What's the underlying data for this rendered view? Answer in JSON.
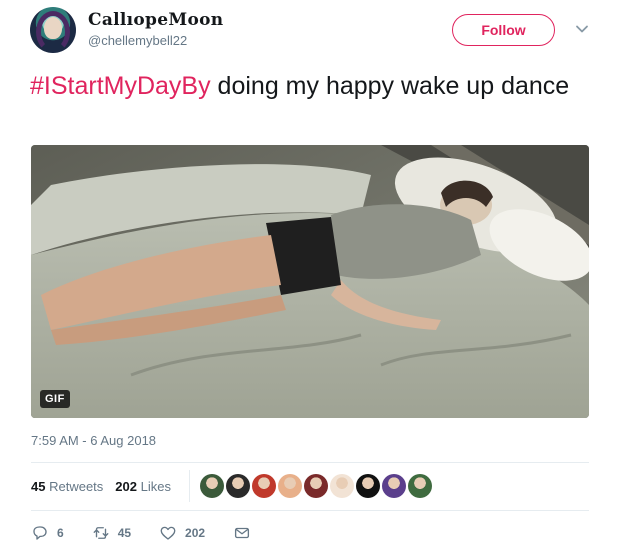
{
  "author": {
    "display_name": "CallıopeMoon",
    "handle": "@chellemybell22",
    "avatar_icon": "avatar"
  },
  "follow_label": "Follow",
  "tweet": {
    "hashtag": "#IStartMyDayBy",
    "text": " doing my happy wake up dance"
  },
  "media": {
    "badge": "GIF",
    "description_icon": "gif-video-person-dancing-in-bed"
  },
  "timestamp": "7:59 AM - 6 Aug 2018",
  "stats": {
    "retweets_count": "45",
    "retweets_label": "Retweets",
    "likes_count": "202",
    "likes_label": "Likes",
    "liker_colors": [
      "#3b5a3a",
      "#2a2a2a",
      "#c0392b",
      "#e8b08a",
      "#7a2a2a",
      "#f2e3d5",
      "#111111",
      "#5b3f8c",
      "#3f6b3f"
    ]
  },
  "actions": {
    "reply_count": "6",
    "retweet_count": "45",
    "like_count": "202"
  },
  "colors": {
    "accent": "#e0245e",
    "muted": "#657786"
  }
}
